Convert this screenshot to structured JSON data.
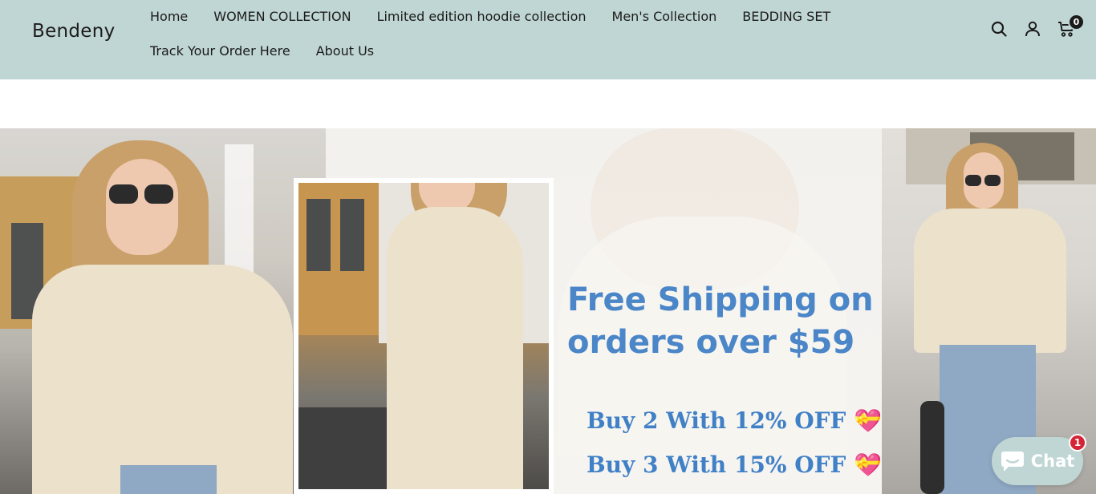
{
  "header": {
    "logo": "Bendeny",
    "nav": [
      {
        "label": "Home"
      },
      {
        "label": "WOMEN COLLECTION"
      },
      {
        "label": "Limited edition hoodie collection"
      },
      {
        "label": "Men's Collection"
      },
      {
        "label": "BEDDING SET"
      },
      {
        "label": "Track Your Order Here"
      },
      {
        "label": "About Us"
      }
    ],
    "icons": [
      "search-icon",
      "account-icon",
      "cart-icon"
    ],
    "cart_count": "0"
  },
  "banner": {
    "headline": "Free Shipping on orders over $59",
    "offers": [
      {
        "text": "Buy 2 With 12% OFF",
        "emoji": "💝"
      },
      {
        "text": "Buy 3 With 15% OFF",
        "emoji": "💝"
      }
    ]
  },
  "chat": {
    "label": "Chat",
    "badge": "1"
  },
  "colors": {
    "header_bg": "#bfd6d4",
    "text": "#1c1b1b",
    "promo_blue": "#4a86c8",
    "badge_red": "#d52436"
  }
}
